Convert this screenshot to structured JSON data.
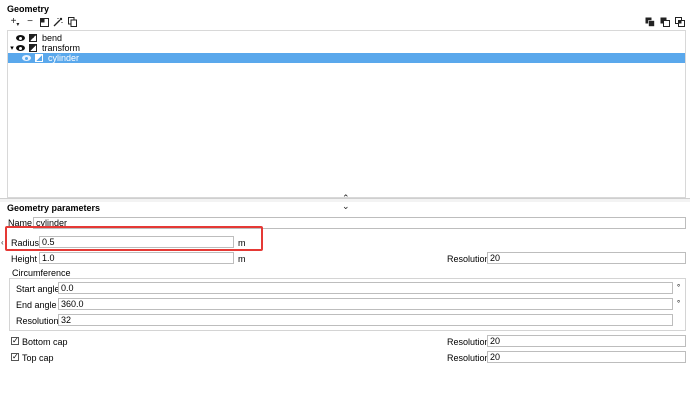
{
  "geometry_panel": {
    "title": "Geometry",
    "toolbar_left": [
      "add-icon",
      "remove-icon",
      "transform-icon",
      "magic-wand-icon",
      "copy-icon"
    ],
    "toolbar_right": [
      "union-icon",
      "difference-icon",
      "intersection-icon"
    ],
    "tree": [
      {
        "label": "bend",
        "level": 0,
        "expanded": false,
        "selected": false
      },
      {
        "label": "transform",
        "level": 0,
        "expanded": true,
        "selected": false
      },
      {
        "label": "cylinder",
        "level": 1,
        "expanded": false,
        "selected": true
      }
    ]
  },
  "params_panel": {
    "title": "Geometry parameters",
    "name_label": "Name",
    "name_value": "cylinder",
    "radius_label": "Radius",
    "radius_value": "0.5",
    "radius_unit": "m",
    "height_label": "Height",
    "height_value": "1.0",
    "height_unit": "m",
    "height_resolution_label": "Resolution",
    "height_resolution_value": "20",
    "circumference_label": "Circumference",
    "start_angle_label": "Start angle",
    "start_angle_value": "0.0",
    "start_angle_unit": "°",
    "end_angle_label": "End angle",
    "end_angle_value": "360.0",
    "end_angle_unit": "°",
    "circ_resolution_label": "Resolution",
    "circ_resolution_value": "32",
    "bottom_cap_label": "Bottom cap",
    "bottom_cap_checked": true,
    "bottom_cap_resolution_label": "Resolution",
    "bottom_cap_resolution_value": "20",
    "top_cap_label": "Top cap",
    "top_cap_checked": true,
    "top_cap_resolution_label": "Resolution",
    "top_cap_resolution_value": "20"
  },
  "colors": {
    "selection": "#5aa8ec",
    "highlight": "#e53935"
  }
}
